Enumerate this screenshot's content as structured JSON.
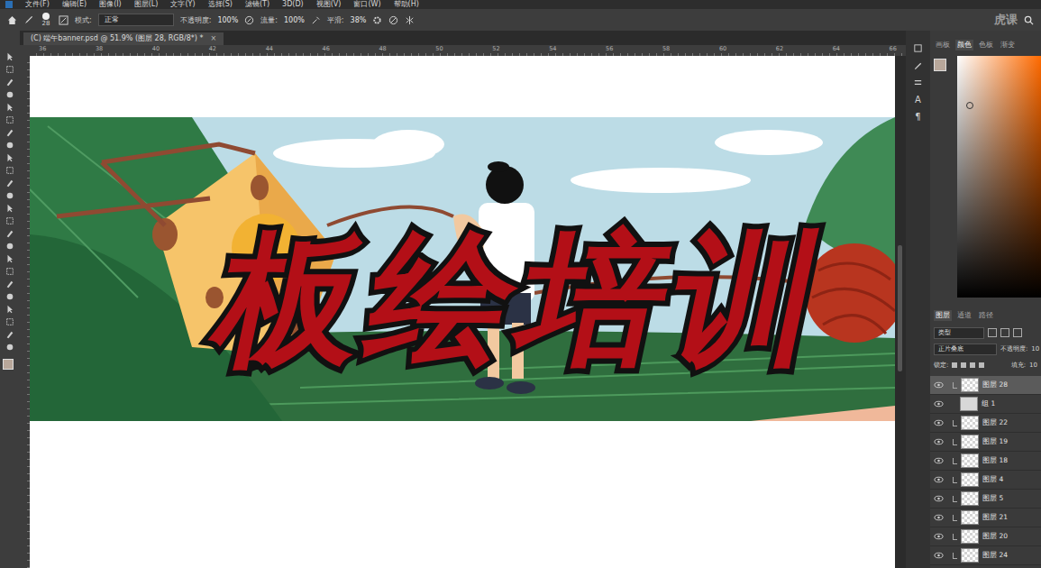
{
  "window": {
    "title": "Photoshop"
  },
  "menu": [
    "文件(F)",
    "编辑(E)",
    "图像(I)",
    "图层(L)",
    "文字(Y)",
    "选择(S)",
    "滤镜(T)",
    "3D(D)",
    "视图(V)",
    "窗口(W)",
    "帮助(H)"
  ],
  "watermark": "虎课",
  "options_bar": {
    "brush_size": "28",
    "mode_label": "模式:",
    "mode": "正常",
    "opacity_label": "不透明度:",
    "opacity": "100%",
    "flow_label": "流量:",
    "flow": "100%",
    "smoothing_label": "平滑:",
    "smoothing": "38%"
  },
  "document_tab": {
    "label": "(C) 端午banner.psd @ 51.9% (图层 28, RGB/8*) *",
    "close": "×"
  },
  "ruler": [
    "36",
    "38",
    "40",
    "42",
    "44",
    "46",
    "48",
    "50",
    "52",
    "54",
    "56",
    "58",
    "60",
    "62",
    "64",
    "66"
  ],
  "canvas": {
    "title": "板绘培训"
  },
  "side_glyphs": [
    "A",
    "¶"
  ],
  "panel_tabs": [
    {
      "label": "画板",
      "selected": false
    },
    {
      "label": "颜色",
      "selected": true
    },
    {
      "label": "色板",
      "selected": false
    },
    {
      "label": "渐变",
      "selected": false
    }
  ],
  "layers_panel": {
    "tabs": [
      {
        "label": "图层",
        "selected": true
      },
      {
        "label": "通道",
        "selected": false
      },
      {
        "label": "路径",
        "selected": false
      }
    ],
    "filter": "类型",
    "blend_mode": "正片叠底",
    "opacity_label": "不透明度:",
    "opacity": "10",
    "lock_label": "锁定:",
    "fill_label": "填充:",
    "fill": "10",
    "layers": [
      {
        "name": "图层 28",
        "selected": true,
        "visible": true,
        "kind": "layer"
      },
      {
        "name": "组 1",
        "selected": false,
        "visible": true,
        "kind": "group"
      },
      {
        "name": "图层 22",
        "selected": false,
        "visible": true,
        "kind": "layer"
      },
      {
        "name": "图层 19",
        "selected": false,
        "visible": true,
        "kind": "layer"
      },
      {
        "name": "图层 18",
        "selected": false,
        "visible": true,
        "kind": "layer"
      },
      {
        "name": "图层 4",
        "selected": false,
        "visible": true,
        "kind": "layer"
      },
      {
        "name": "图层 5",
        "selected": false,
        "visible": true,
        "kind": "layer"
      },
      {
        "name": "图层 21",
        "selected": false,
        "visible": true,
        "kind": "layer"
      },
      {
        "name": "图层 20",
        "selected": false,
        "visible": true,
        "kind": "layer"
      },
      {
        "name": "图层 24",
        "selected": false,
        "visible": true,
        "kind": "layer"
      }
    ]
  }
}
